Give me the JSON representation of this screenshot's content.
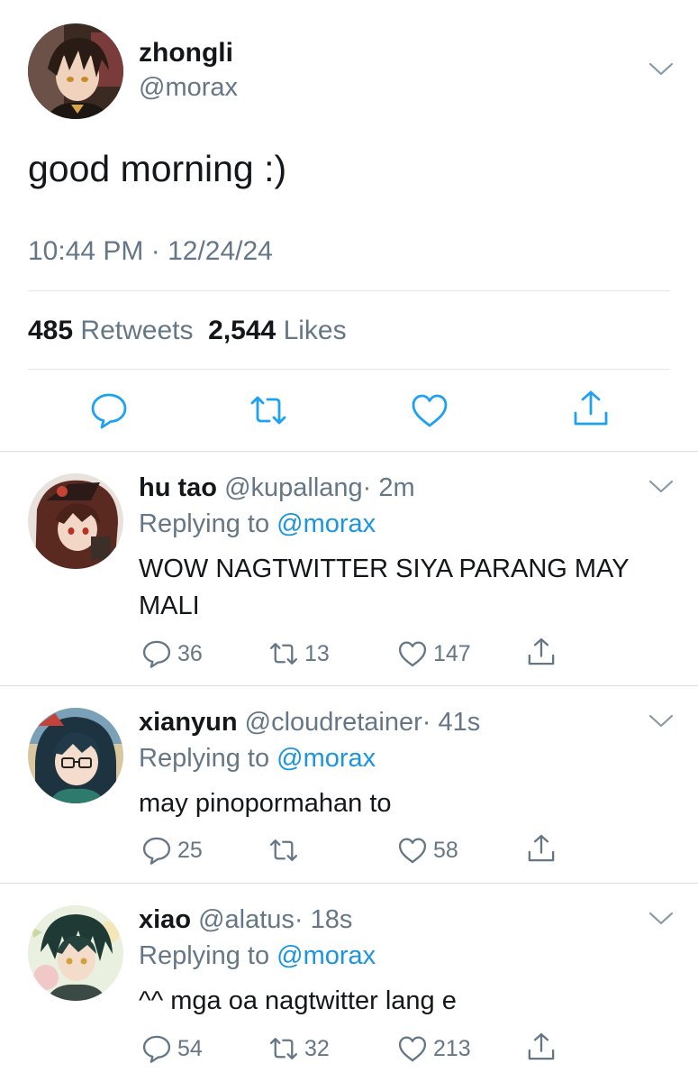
{
  "main_tweet": {
    "display_name": "zhongli",
    "handle": "@morax",
    "text": "good morning :)",
    "timestamp": "10:44 PM · 12/24/24",
    "retweets_count": "485",
    "retweets_label": "Retweets",
    "likes_count": "2,544",
    "likes_label": "Likes",
    "icons": [
      "reply-icon",
      "retweet-icon",
      "like-icon",
      "share-icon"
    ]
  },
  "replies": [
    {
      "display_name": "hu tao",
      "handle": "@kupallang",
      "time": "· 2m",
      "replying_label": "Replying to",
      "replying_to": "@morax",
      "text": "WOW NAGTWITTER SIYA PARANG MAY MALI",
      "reply_count": "36",
      "retweet_count": "13",
      "like_count": "147"
    },
    {
      "display_name": "xianyun",
      "handle": "@cloudretainer",
      "time": "· 41s",
      "replying_label": "Replying to",
      "replying_to": "@morax",
      "text": "may pinopormahan to",
      "reply_count": "25",
      "retweet_count": "",
      "like_count": "58"
    },
    {
      "display_name": "xiao",
      "handle": "@alatus",
      "time": "· 18s",
      "replying_label": "Replying to",
      "replying_to": "@morax",
      "text": "^^ mga oa nagtwitter lang e",
      "reply_count": "54",
      "retweet_count": "32",
      "like_count": "213"
    }
  ],
  "colors": {
    "text": "#14171a",
    "secondary": "#657786",
    "link": "#1b95e0",
    "divider": "#e1e8ed"
  }
}
